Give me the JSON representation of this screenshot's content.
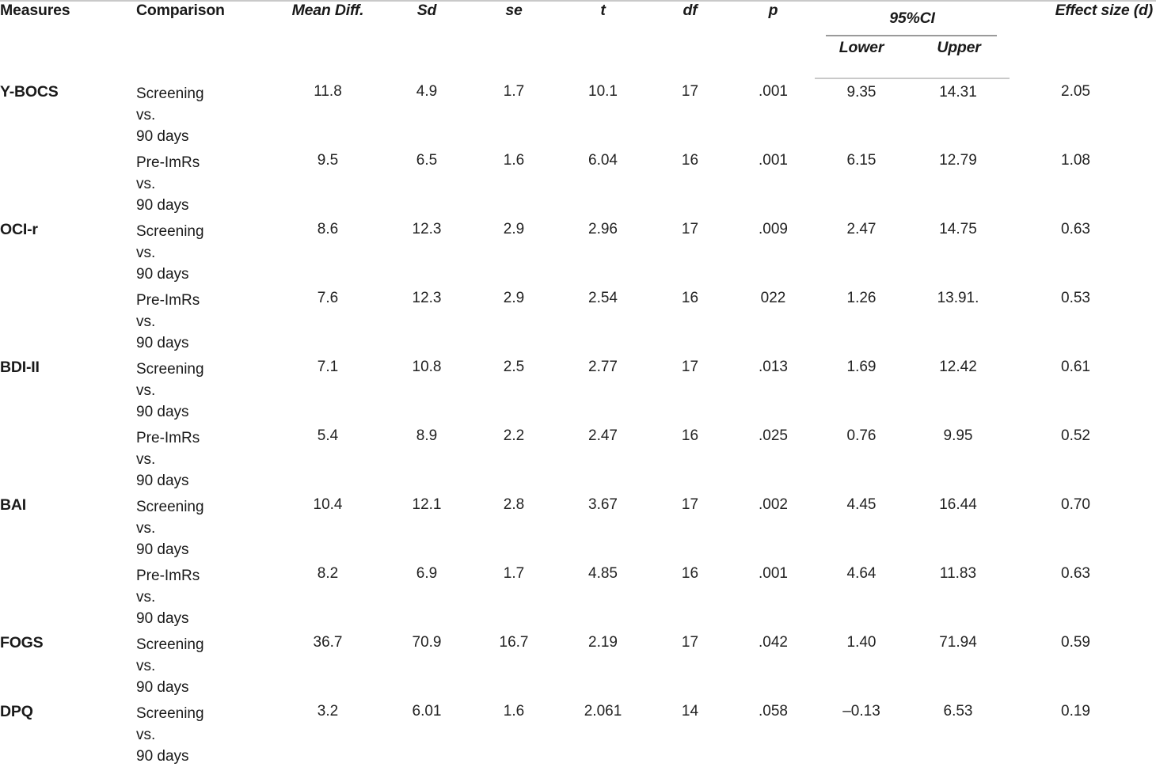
{
  "table": {
    "headers": {
      "measures": "Measures",
      "comparison": "Comparison",
      "mean_diff": "Mean Diff.",
      "sd": "Sd",
      "se": "se",
      "t": "t",
      "df": "df",
      "p": "p",
      "ci_span": "95%CI",
      "ci_lower": "Lower",
      "ci_upper": "Upper",
      "effect_size": "Effect size (d)"
    },
    "rows": [
      {
        "measure": "Y-BOCS",
        "comparison": "Screening\nvs.\n90 days",
        "mean_diff": "11.8",
        "sd": "4.9",
        "se": "1.7",
        "t": "10.1",
        "df": "17",
        "p": ".001",
        "ci_lower": "9.35",
        "ci_upper": "14.31",
        "effect_size": "2.05"
      },
      {
        "measure": "",
        "comparison": "Pre-ImRs\nvs.\n90 days",
        "mean_diff": "9.5",
        "sd": "6.5",
        "se": "1.6",
        "t": "6.04",
        "df": "16",
        "p": ".001",
        "ci_lower": "6.15",
        "ci_upper": "12.79",
        "effect_size": "1.08"
      },
      {
        "measure": "OCI-r",
        "comparison": "Screening\nvs.\n90 days",
        "mean_diff": "8.6",
        "sd": "12.3",
        "se": "2.9",
        "t": "2.96",
        "df": "17",
        "p": ".009",
        "ci_lower": "2.47",
        "ci_upper": "14.75",
        "effect_size": "0.63"
      },
      {
        "measure": "",
        "comparison": "Pre-ImRs\nvs.\n90 days",
        "mean_diff": "7.6",
        "sd": "12.3",
        "se": "2.9",
        "t": "2.54",
        "df": "16",
        "p": "022",
        "ci_lower": "1.26",
        "ci_upper": "13.91.",
        "effect_size": "0.53"
      },
      {
        "measure": "BDI-II",
        "comparison": "Screening\nvs.\n90 days",
        "mean_diff": "7.1",
        "sd": "10.8",
        "se": "2.5",
        "t": "2.77",
        "df": "17",
        "p": ".013",
        "ci_lower": "1.69",
        "ci_upper": "12.42",
        "effect_size": "0.61"
      },
      {
        "measure": "",
        "comparison": "Pre-ImRs\nvs.\n90 days",
        "mean_diff": "5.4",
        "sd": "8.9",
        "se": "2.2",
        "t": "2.47",
        "df": "16",
        "p": ".025",
        "ci_lower": "0.76",
        "ci_upper": "9.95",
        "effect_size": "0.52"
      },
      {
        "measure": "BAI",
        "comparison": "Screening\nvs.\n90 days",
        "mean_diff": "10.4",
        "sd": "12.1",
        "se": "2.8",
        "t": "3.67",
        "df": "17",
        "p": ".002",
        "ci_lower": "4.45",
        "ci_upper": "16.44",
        "effect_size": "0.70"
      },
      {
        "measure": "",
        "comparison": "Pre-ImRs\nvs.\n90 days",
        "mean_diff": "8.2",
        "sd": "6.9",
        "se": "1.7",
        "t": "4.85",
        "df": "16",
        "p": ".001",
        "ci_lower": "4.64",
        "ci_upper": "11.83",
        "effect_size": "0.63"
      },
      {
        "measure": "FOGS",
        "comparison": "Screening\nvs.\n90 days",
        "mean_diff": "36.7",
        "sd": "70.9",
        "se": "16.7",
        "t": "2.19",
        "df": "17",
        "p": ".042",
        "ci_lower": "1.40",
        "ci_upper": "71.94",
        "effect_size": "0.59"
      },
      {
        "measure": "DPQ",
        "comparison": "Screening\nvs.\n90 days",
        "mean_diff": "3.2",
        "sd": "6.01",
        "se": "1.6",
        "t": "2.061",
        "df": "14",
        "p": ".058",
        "ci_lower": "–0.13",
        "ci_upper": "6.53",
        "effect_size": "0.19"
      }
    ]
  },
  "colors": {
    "rule": "#c9c9c9",
    "spanner_rule": "#9a9a9a",
    "text": "#1a1a1a",
    "background": "#ffffff"
  }
}
